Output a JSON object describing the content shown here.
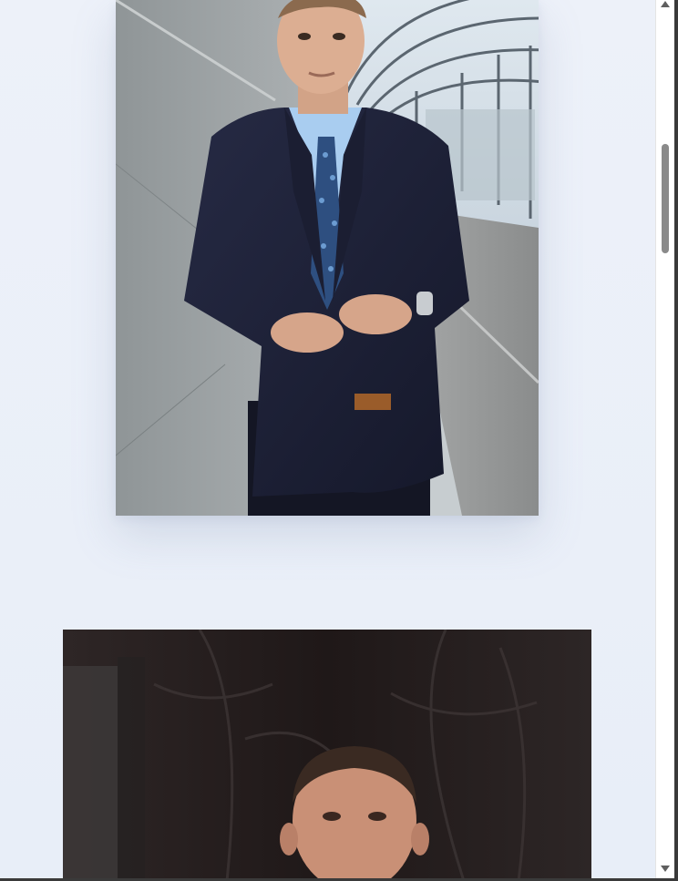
{
  "page": {
    "background": "#edf1f9"
  },
  "photos": [
    {
      "subject": "man-in-navy-suit-buttoning-jacket",
      "icon": "photo-icon"
    },
    {
      "subject": "man-portrait-dark-background",
      "icon": "photo-icon"
    }
  ],
  "scrollbar": {
    "position_fraction": 0.18
  },
  "colors": {
    "suit": "#1c1f33",
    "shirt": "#a9cdf0",
    "tie": "#2e4f80",
    "wall": "#9ca3a6",
    "dark_background": "#2a2020"
  }
}
